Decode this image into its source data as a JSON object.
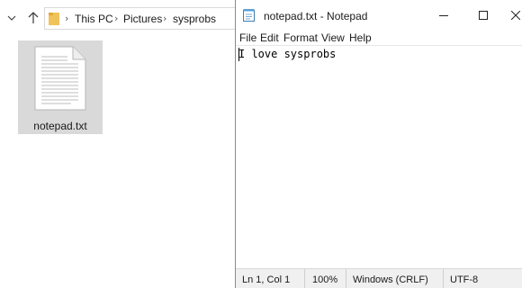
{
  "explorer": {
    "breadcrumb": [
      "This PC",
      "Pictures",
      "sysprobs"
    ],
    "file": {
      "name": "notepad.txt"
    }
  },
  "notepad": {
    "title": "notepad.txt - Notepad",
    "menu": [
      "File",
      "Edit",
      "Format",
      "View",
      "Help"
    ],
    "content": "I love sysprobs",
    "status": {
      "position": "Ln 1, Col 1",
      "zoom": "100%",
      "line_ending": "Windows (CRLF)",
      "encoding": "UTF-8"
    }
  },
  "colors": {
    "folder": "#f0c35a",
    "tile_selected": "#d9d9d9",
    "status_bg": "#f0f0f0"
  }
}
